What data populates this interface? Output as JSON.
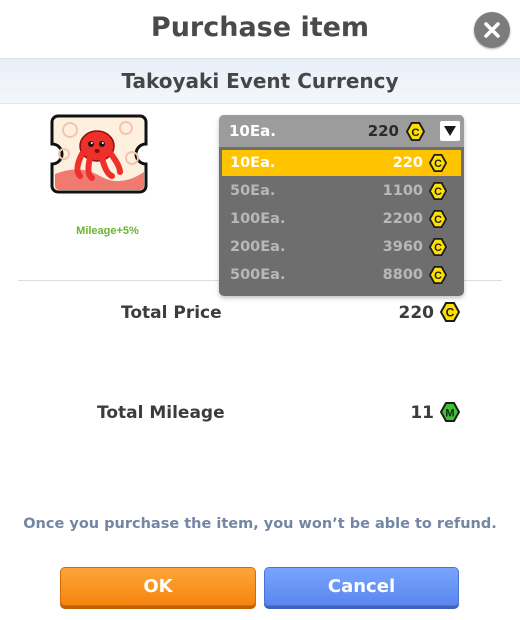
{
  "header": {
    "title": "Purchase item"
  },
  "subheader": {
    "title": "Takoyaki Event Currency"
  },
  "item": {
    "icon": "octopus-ticket-icon",
    "mileage_bonus": "Mileage+5%"
  },
  "dropdown": {
    "selected_qty": "10Ea.",
    "selected_price": "220",
    "options": [
      {
        "qty": "10Ea.",
        "price": "220"
      },
      {
        "qty": "50Ea.",
        "price": "1100"
      },
      {
        "qty": "100Ea.",
        "price": "2200"
      },
      {
        "qty": "200Ea.",
        "price": "3960"
      },
      {
        "qty": "500Ea.",
        "price": "8800"
      }
    ]
  },
  "summary": {
    "total_price_label": "Total Price",
    "total_price_value": "220",
    "total_mileage_label": "Total Mileage",
    "total_mileage_value": "11"
  },
  "notice": "Once you purchase the item, you won’t be able to refund.",
  "buttons": {
    "ok": "OK",
    "cancel": "Cancel"
  },
  "icons": {
    "coin": "coin-c-icon",
    "mileage": "mileage-m-icon",
    "close": "close-icon",
    "arrow": "triangle-down-icon"
  },
  "colors": {
    "ok": "#f5850f",
    "cancel": "#5a87ee",
    "highlight": "#ffc400",
    "coin": "#ffe100",
    "mileage": "#39c52f"
  }
}
